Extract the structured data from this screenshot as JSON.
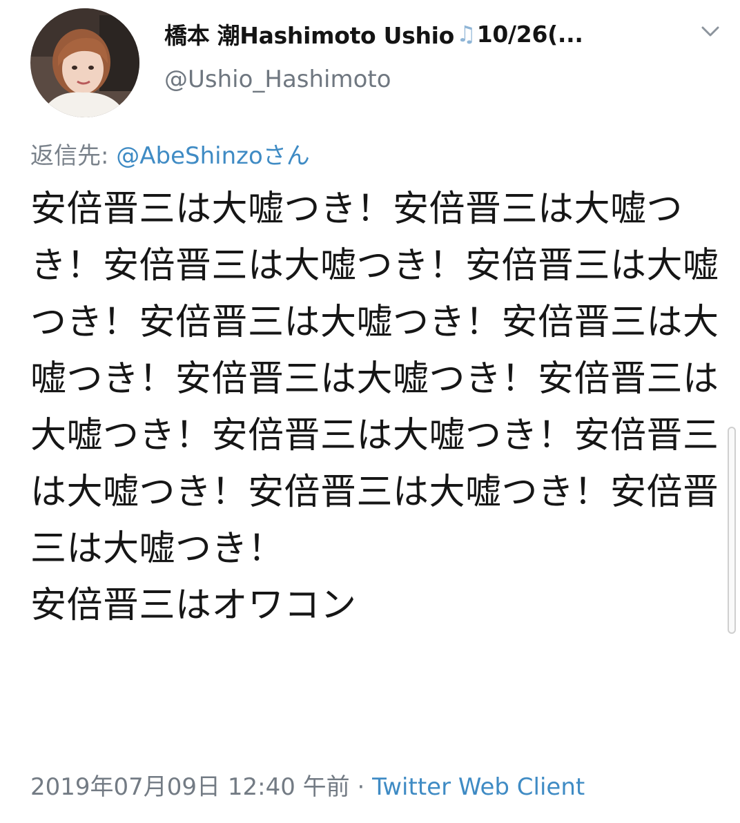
{
  "author": {
    "display_name": "橋本 潮Hashimoto Ushio",
    "name_suffix": "10/26(...",
    "handle": "@Ushio_Hashimoto",
    "avatar_icon": "profile-photo",
    "name_icon": "music-notes-icon"
  },
  "reply": {
    "prefix": "返信先: ",
    "mention": "@AbeShinzoさん"
  },
  "tweet": {
    "text": "安倍晋三は大嘘つき！安倍晋三は大嘘つき！安倍晋三は大嘘つき！安倍晋三は大嘘つき！安倍晋三は大嘘つき！安倍晋三は大嘘つき！安倍晋三は大嘘つき！安倍晋三は大嘘つき！安倍晋三は大嘘つき！安倍晋三は大嘘つき！安倍晋三は大嘘つき！安倍晋三は大嘘つき！\n安倍晋三はオワコン"
  },
  "meta": {
    "timestamp": "2019年07月09日 12:40 午前",
    "separator": " · ",
    "client": "Twitter Web Client"
  },
  "menu": {
    "icon": "chevron-down-icon"
  },
  "colors": {
    "link": "#3f8bc4",
    "secondary": "#737b84",
    "text": "#161616"
  }
}
